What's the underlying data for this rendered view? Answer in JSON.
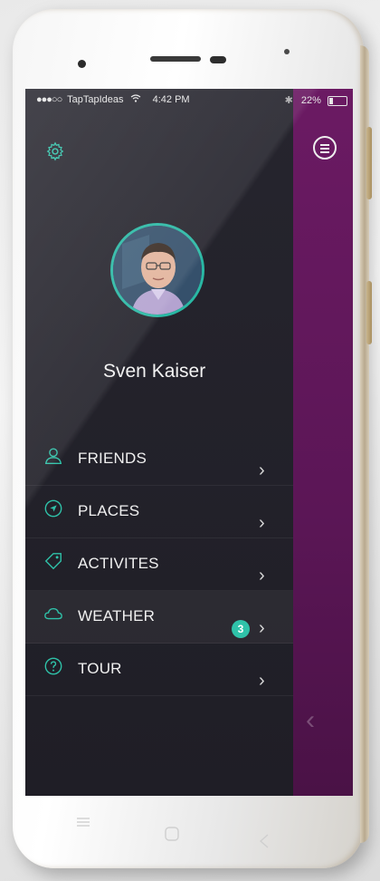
{
  "status_bar": {
    "signal": "●●●○○",
    "carrier": "TapTapIdeas",
    "wifi_icon": "wifi-icon",
    "time": "4:42 PM",
    "battery_percent": "22%",
    "battery_level": 0.22
  },
  "header": {
    "settings_icon": "gear-icon",
    "menu_icon": "hamburger-icon"
  },
  "profile": {
    "name": "Sven Kaiser",
    "avatar_icon": "user-avatar"
  },
  "menu": {
    "items": [
      {
        "label": "FRIENDS",
        "icon": "user-icon"
      },
      {
        "label": "PLACES",
        "icon": "location-arrow-icon"
      },
      {
        "label": "ACTIVITES",
        "icon": "tag-icon"
      },
      {
        "label": "WEATHER",
        "icon": "cloud-icon",
        "badge": "3"
      },
      {
        "label": "TOUR",
        "icon": "question-icon"
      }
    ],
    "chevron": "›"
  },
  "colors": {
    "accent": "#2fc2a9",
    "panel": "#23222b",
    "side_panel": "#6b1a63"
  }
}
